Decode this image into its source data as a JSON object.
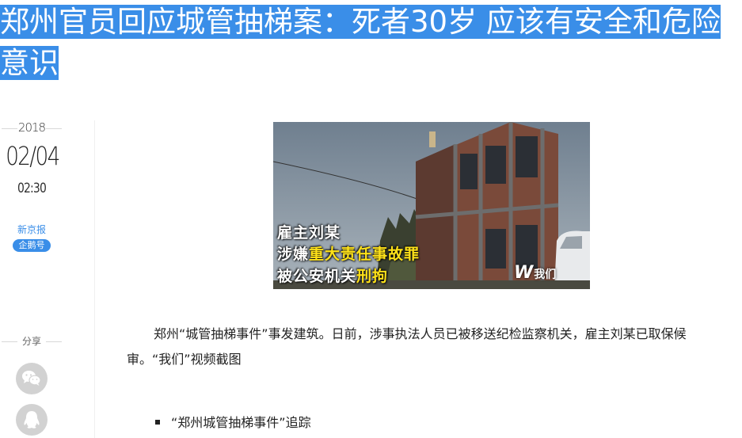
{
  "article": {
    "title": "郑州官员回应城管抽梯案：死者30岁 应该有安全和危险意识",
    "paragraph": "郑州“城管抽梯事件”事发建筑。日前，涉事执法人员已被移送纪检监察机关，雇主刘某已取保候审。“我们”视频截图",
    "related_item": "“郑州城管抽梯事件”追踪"
  },
  "meta": {
    "year": "2018",
    "date": "02/04",
    "time": "02:30",
    "source": "新京报",
    "badge": "企鹅号"
  },
  "share": {
    "label": "分享",
    "buttons": [
      "wechat-icon",
      "qq-icon"
    ]
  },
  "image": {
    "caption_line1": "雇主刘某",
    "caption_line2_prefix": "涉嫌",
    "caption_line2_highlight": "重大责任事故罪",
    "caption_line3_prefix": "被公安机关",
    "caption_line3_highlight": "刑拘",
    "watermark": "我们",
    "watermark_logo": "W"
  },
  "colors": {
    "selection": "#3a8ee8",
    "caption_highlight": "#ffe21a"
  }
}
